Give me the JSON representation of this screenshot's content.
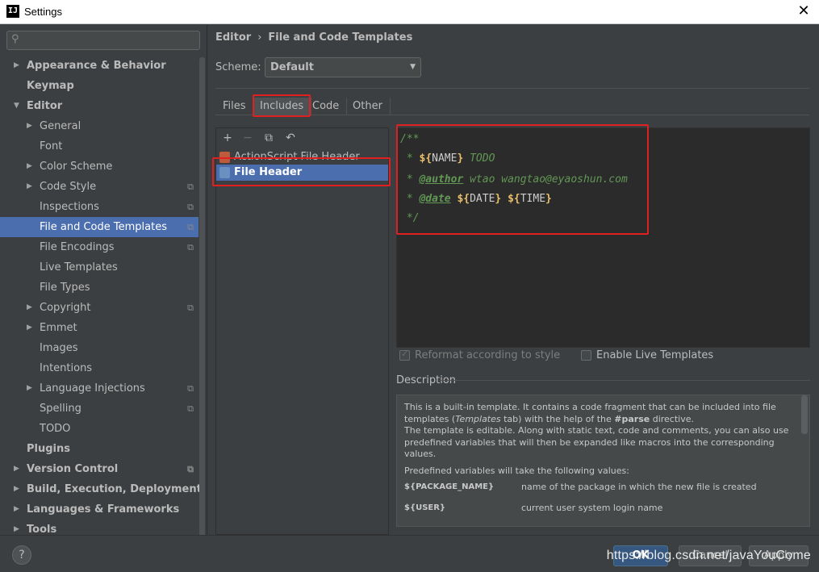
{
  "window": {
    "title": "Settings",
    "app_icon": "IJ",
    "close_glyph": "✕"
  },
  "sidebar": {
    "items": [
      {
        "label": "Appearance & Behavior",
        "level": 0,
        "bold": true,
        "expandable": true,
        "expanded": false,
        "copy": false
      },
      {
        "label": "Keymap",
        "level": 0,
        "bold": true,
        "expandable": false,
        "copy": false
      },
      {
        "label": "Editor",
        "level": 0,
        "bold": true,
        "expandable": true,
        "expanded": true,
        "copy": false
      },
      {
        "label": "General",
        "level": 1,
        "expandable": true,
        "expanded": false,
        "copy": false
      },
      {
        "label": "Font",
        "level": 1,
        "expandable": false,
        "copy": false
      },
      {
        "label": "Color Scheme",
        "level": 1,
        "expandable": true,
        "expanded": false,
        "copy": false
      },
      {
        "label": "Code Style",
        "level": 1,
        "expandable": true,
        "expanded": false,
        "copy": true
      },
      {
        "label": "Inspections",
        "level": 1,
        "expandable": false,
        "copy": true
      },
      {
        "label": "File and Code Templates",
        "level": 1,
        "expandable": false,
        "copy": true,
        "selected": true
      },
      {
        "label": "File Encodings",
        "level": 1,
        "expandable": false,
        "copy": true
      },
      {
        "label": "Live Templates",
        "level": 1,
        "expandable": false,
        "copy": false
      },
      {
        "label": "File Types",
        "level": 1,
        "expandable": false,
        "copy": false
      },
      {
        "label": "Copyright",
        "level": 1,
        "expandable": true,
        "expanded": false,
        "copy": true
      },
      {
        "label": "Emmet",
        "level": 1,
        "expandable": true,
        "expanded": false,
        "copy": false
      },
      {
        "label": "Images",
        "level": 1,
        "expandable": false,
        "copy": false
      },
      {
        "label": "Intentions",
        "level": 1,
        "expandable": false,
        "copy": false
      },
      {
        "label": "Language Injections",
        "level": 1,
        "expandable": true,
        "expanded": false,
        "copy": true
      },
      {
        "label": "Spelling",
        "level": 1,
        "expandable": false,
        "copy": true
      },
      {
        "label": "TODO",
        "level": 1,
        "expandable": false,
        "copy": false
      },
      {
        "label": "Plugins",
        "level": 0,
        "bold": true,
        "expandable": false,
        "copy": false
      },
      {
        "label": "Version Control",
        "level": 0,
        "bold": true,
        "expandable": true,
        "expanded": false,
        "copy": true
      },
      {
        "label": "Build, Execution, Deployment",
        "level": 0,
        "bold": true,
        "expandable": true,
        "expanded": false,
        "copy": false
      },
      {
        "label": "Languages & Frameworks",
        "level": 0,
        "bold": true,
        "expandable": true,
        "expanded": false,
        "copy": false
      },
      {
        "label": "Tools",
        "level": 0,
        "bold": true,
        "expandable": true,
        "expanded": false,
        "copy": false
      }
    ]
  },
  "breadcrumb": {
    "parent": "Editor",
    "separator": "›",
    "current": "File and Code Templates"
  },
  "scheme": {
    "label": "Scheme:",
    "value": "Default"
  },
  "tabs": [
    {
      "label": "Files",
      "active": false
    },
    {
      "label": "Includes",
      "active": true
    },
    {
      "label": "Code",
      "active": false
    },
    {
      "label": "Other",
      "active": false
    }
  ],
  "templates": {
    "toolbar": {
      "add": "+",
      "remove": "−",
      "copy": "⧉",
      "reset": "↶"
    },
    "items": [
      {
        "label": "ActionScript File Header",
        "selected": false
      },
      {
        "label": "File Header",
        "selected": true
      }
    ]
  },
  "editor": {
    "lines": [
      "/**",
      " * ${NAME} TODO",
      " * @author wtao wangtao@eyaoshun.com",
      " * @date ${DATE} ${TIME}",
      " */"
    ]
  },
  "options": {
    "reformat": {
      "label": "Reformat according to style",
      "checked": true,
      "enabled": false
    },
    "live_templates": {
      "label": "Enable Live Templates",
      "checked": false,
      "enabled": true
    }
  },
  "description": {
    "label": "Description",
    "para1_a": "This is a built-in template. It contains a code fragment that can be included into file templates (",
    "para1_em": "Templates",
    "para1_b": " tab) with the help of the ",
    "para1_strong": "#parse",
    "para1_c": " directive.",
    "para2": "The template is editable. Along with static text, code and comments, you can also use predefined variables that will then be expanded like macros into the corresponding values.",
    "para3": "Predefined variables will take the following values:",
    "vars": [
      {
        "name": "${PACKAGE_NAME}",
        "desc": "name of the package in which the new file is created"
      },
      {
        "name": "${USER}",
        "desc": "current user system login name"
      }
    ]
  },
  "footer": {
    "help": "?",
    "ok": "OK",
    "cancel": "Cancel",
    "apply": "Apply",
    "watermark": "https://blog.csdn.net/javaYouCome"
  },
  "colors": {
    "accent": "#4b6eaf",
    "highlight_box": "#e02020",
    "comment": "#629755",
    "variable": "#e8bf6a"
  }
}
